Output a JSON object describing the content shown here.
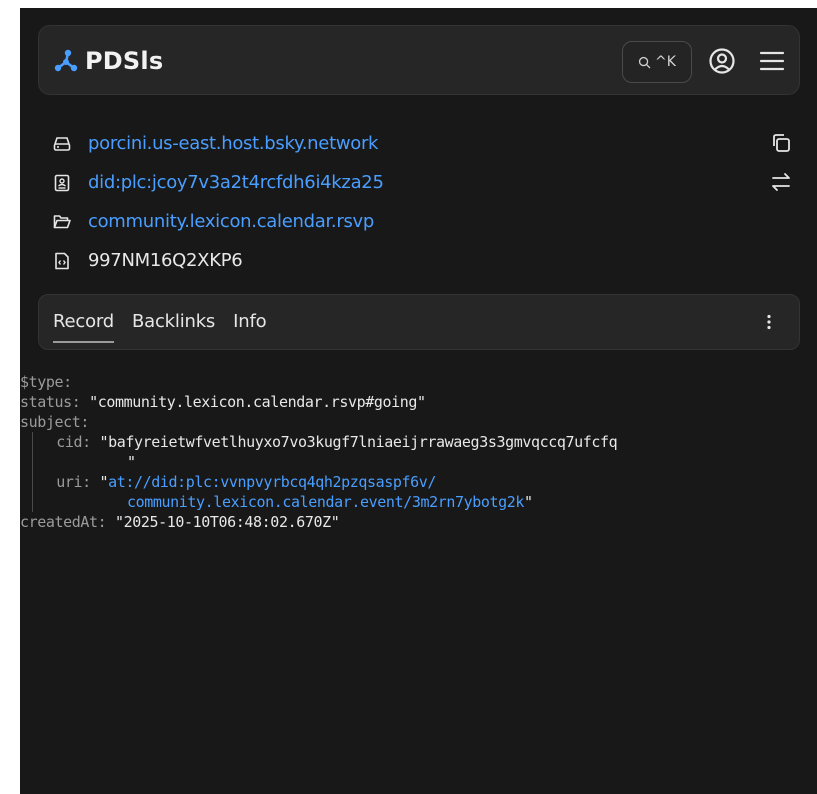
{
  "header": {
    "title": "PDSls",
    "search_shortcut": "^K",
    "icons": {
      "brand": "pdsls-logo-icon",
      "search": "search-icon",
      "account": "account-circle-icon",
      "menu": "hamburger-menu-icon"
    }
  },
  "identity": {
    "host": "porcini.us-east.host.bsky.network",
    "did": "did:plc:jcoy7v3a2t4rcfdh6i4kza25",
    "collection": "community.lexicon.calendar.rsvp",
    "rkey": "997NM16Q2XKP6",
    "icons": {
      "host": "hard-drive-icon",
      "did": "id-badge-icon",
      "collection": "folder-open-icon",
      "rkey": "file-code-icon",
      "copy": "copy-icon",
      "switch": "arrows-swap-icon"
    }
  },
  "tabs": {
    "items": [
      "Record",
      "Backlinks",
      "Info"
    ],
    "active": "Record",
    "more_icon": "more-vertical-icon"
  },
  "record": {
    "type_key": "$type:",
    "status_key": "status:",
    "status_value": "\"community.lexicon.calendar.rsvp#going\"",
    "subject_key": "subject:",
    "cid_key": "cid:",
    "cid_value_line1": "\"bafyreietwfvetlhuyxo7vo3kugf7lniaeijrrawaeg3s3gmvqccq7ufcfq",
    "cid_value_line2": "\"",
    "uri_key": "uri:",
    "uri_quote_open": "\"",
    "uri_value_line1": "at://did:plc:vvnpvyrbcq4qh2pzqsaspf6v/",
    "uri_value_line2": "community.lexicon.calendar.event/3m2rn7ybotg2k",
    "uri_quote_close": "\"",
    "created_key": "createdAt:",
    "created_value": "\"2025-10-10T06:48:02.670Z\""
  },
  "colors": {
    "background": "#181818",
    "panel": "#262626",
    "link": "#4a9eff",
    "key": "#9b9b9b",
    "text": "#e8e8e8"
  }
}
